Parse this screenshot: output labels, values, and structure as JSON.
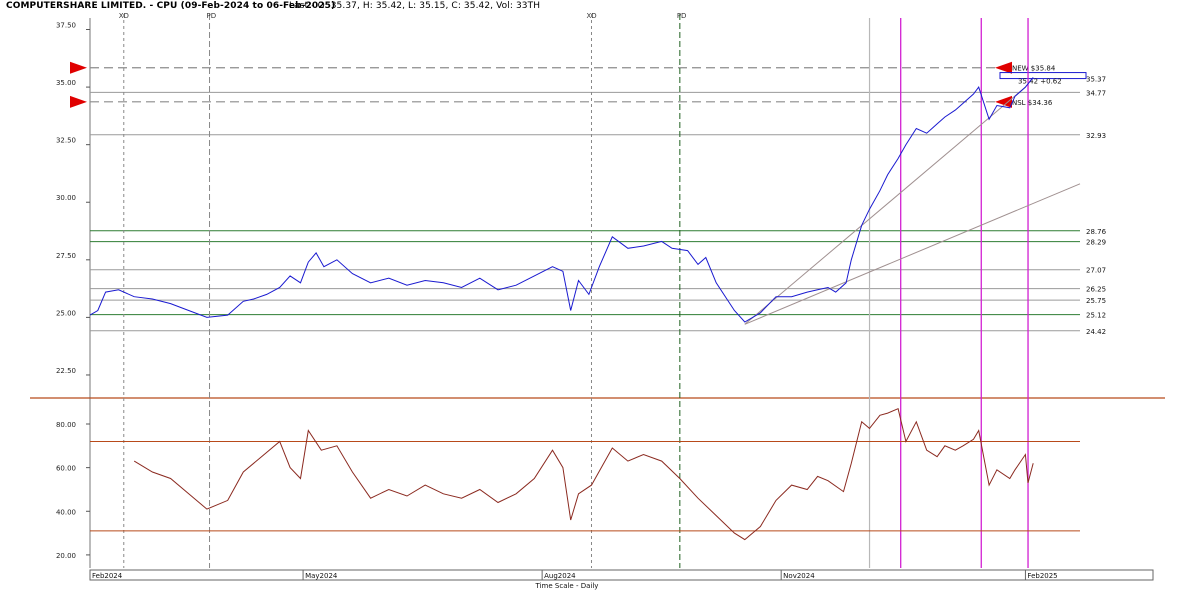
{
  "header": {
    "title": "COMPUTERSHARE LIMITED. - CPU (09-Feb-2024 to 06-Feb-2025)",
    "last_prices": "Last:- O: 35.37, H: 35.42, L: 35.15, C: 35.42, Vol: 33TH"
  },
  "colors": {
    "price": "#1a1ad0",
    "rsi": "#8b2a20",
    "divider": "#b84a1a",
    "green_level": "#2e7d32",
    "grey_level": "#9a9a9a",
    "dashed": "#8c8c8c",
    "magenta": "#d21fd2",
    "trend": "#a09090",
    "marker": "#e00000",
    "fd_line": "#1f5f1f"
  },
  "chart_data": [
    {
      "type": "line",
      "title": "",
      "series": [
        {
          "name": "",
          "points": [
            [
              "2024-02-09",
              25.1
            ],
            [
              "2024-02-12",
              25.3
            ],
            [
              "2024-02-15",
              26.1
            ],
            [
              "2024-02-20",
              26.2
            ],
            [
              "2024-02-26",
              25.9
            ],
            [
              "2024-03-04",
              25.8
            ],
            [
              "2024-03-11",
              25.6
            ],
            [
              "2024-03-18",
              25.3
            ],
            [
              "2024-03-25",
              25.0
            ],
            [
              "2024-04-02",
              25.1
            ],
            [
              "2024-04-08",
              25.7
            ],
            [
              "2024-04-12",
              25.8
            ],
            [
              "2024-04-17",
              26.0
            ],
            [
              "2024-04-22",
              26.3
            ],
            [
              "2024-04-26",
              26.8
            ],
            [
              "2024-04-30",
              26.5
            ],
            [
              "2024-05-03",
              27.4
            ],
            [
              "2024-05-06",
              27.8
            ],
            [
              "2024-05-09",
              27.2
            ],
            [
              "2024-05-14",
              27.5
            ],
            [
              "2024-05-20",
              26.9
            ],
            [
              "2024-05-27",
              26.5
            ],
            [
              "2024-06-03",
              26.7
            ],
            [
              "2024-06-10",
              26.4
            ],
            [
              "2024-06-17",
              26.6
            ],
            [
              "2024-06-24",
              26.5
            ],
            [
              "2024-07-01",
              26.3
            ],
            [
              "2024-07-08",
              26.7
            ],
            [
              "2024-07-15",
              26.2
            ],
            [
              "2024-07-22",
              26.4
            ],
            [
              "2024-07-29",
              26.8
            ],
            [
              "2024-08-05",
              27.2
            ],
            [
              "2024-08-09",
              27.0
            ],
            [
              "2024-08-12",
              25.3
            ],
            [
              "2024-08-15",
              26.6
            ],
            [
              "2024-08-19",
              26.0
            ],
            [
              "2024-08-23",
              27.2
            ],
            [
              "2024-08-28",
              28.5
            ],
            [
              "2024-09-03",
              28.0
            ],
            [
              "2024-09-09",
              28.1
            ],
            [
              "2024-09-16",
              28.3
            ],
            [
              "2024-09-20",
              28.0
            ],
            [
              "2024-09-26",
              27.9
            ],
            [
              "2024-09-30",
              27.3
            ],
            [
              "2024-10-03",
              27.6
            ],
            [
              "2024-10-07",
              26.5
            ],
            [
              "2024-10-14",
              25.3
            ],
            [
              "2024-10-18",
              24.8
            ],
            [
              "2024-10-24",
              25.2
            ],
            [
              "2024-10-30",
              25.9
            ],
            [
              "2024-11-05",
              25.9
            ],
            [
              "2024-11-11",
              26.1
            ],
            [
              "2024-11-15",
              26.2
            ],
            [
              "2024-11-19",
              26.3
            ],
            [
              "2024-11-22",
              26.1
            ],
            [
              "2024-11-26",
              26.5
            ],
            [
              "2024-11-28",
              27.5
            ],
            [
              "2024-12-02",
              29.0
            ],
            [
              "2024-12-05",
              29.7
            ],
            [
              "2024-12-09",
              30.5
            ],
            [
              "2024-12-12",
              31.2
            ],
            [
              "2024-12-16",
              31.9
            ],
            [
              "2024-12-19",
              32.5
            ],
            [
              "2024-12-23",
              33.2
            ],
            [
              "2024-12-27",
              33.0
            ],
            [
              "2024-12-31",
              33.4
            ],
            [
              "2025-01-03",
              33.7
            ],
            [
              "2025-01-07",
              34.0
            ],
            [
              "2025-01-10",
              34.3
            ],
            [
              "2025-01-14",
              34.7
            ],
            [
              "2025-01-16",
              35.0
            ],
            [
              "2025-01-20",
              33.6
            ],
            [
              "2025-01-23",
              34.2
            ],
            [
              "2025-01-28",
              34.1
            ],
            [
              "2025-01-30",
              34.6
            ],
            [
              "2025-02-03",
              35.0
            ],
            [
              "2025-02-06",
              35.42
            ]
          ]
        }
      ],
      "ylim": [
        21.5,
        38.0
      ],
      "y_ticks": [
        "37.50",
        "35.00",
        "32.50",
        "30.00",
        "27.50",
        "25.00",
        "22.50"
      ],
      "levels": {
        "green": [
          "28.76",
          "28.29",
          "25.12"
        ],
        "grey": [
          "34.77",
          "32.93",
          "27.07",
          "26.25",
          "25.75",
          "24.42"
        ]
      },
      "guides": {
        "new": "NEW $35.84",
        "nsl": "NSL $34.36",
        "last": "35.37",
        "pp_label": "35.42 +0.62"
      },
      "event_labels": {
        "xd": "XD",
        "pd": "PD"
      },
      "event_dates": {
        "xd": [
          "2024-02-22",
          "2024-08-20"
        ],
        "pd": [
          "2024-03-26",
          "2024-09-23"
        ]
      },
      "magenta_dates": [
        "2024-12-17",
        "2025-01-17",
        "2025-02-04"
      ],
      "grey_vline_date": "2024-12-05",
      "trendlines": [
        {
          "from": [
            "2024-10-18",
            24.7
          ],
          "to": [
            "2025-02-03",
            35.0
          ]
        },
        {
          "from": [
            "2024-10-18",
            24.7
          ],
          "to": [
            "2025-02-24",
            30.8
          ]
        }
      ]
    },
    {
      "type": "line",
      "title": "",
      "series": [
        {
          "name": "",
          "points": [
            [
              "2024-02-26",
              63
            ],
            [
              "2024-03-04",
              58
            ],
            [
              "2024-03-11",
              55
            ],
            [
              "2024-03-18",
              48
            ],
            [
              "2024-03-25",
              41
            ],
            [
              "2024-04-02",
              45
            ],
            [
              "2024-04-08",
              58
            ],
            [
              "2024-04-15",
              65
            ],
            [
              "2024-04-22",
              72
            ],
            [
              "2024-04-26",
              60
            ],
            [
              "2024-04-30",
              55
            ],
            [
              "2024-05-03",
              77
            ],
            [
              "2024-05-08",
              68
            ],
            [
              "2024-05-14",
              70
            ],
            [
              "2024-05-20",
              58
            ],
            [
              "2024-05-27",
              46
            ],
            [
              "2024-06-03",
              50
            ],
            [
              "2024-06-10",
              47
            ],
            [
              "2024-06-17",
              52
            ],
            [
              "2024-06-24",
              48
            ],
            [
              "2024-07-01",
              46
            ],
            [
              "2024-07-08",
              50
            ],
            [
              "2024-07-15",
              44
            ],
            [
              "2024-07-22",
              48
            ],
            [
              "2024-07-29",
              55
            ],
            [
              "2024-08-05",
              68
            ],
            [
              "2024-08-09",
              60
            ],
            [
              "2024-08-12",
              36
            ],
            [
              "2024-08-15",
              48
            ],
            [
              "2024-08-20",
              52
            ],
            [
              "2024-08-28",
              69
            ],
            [
              "2024-09-03",
              63
            ],
            [
              "2024-09-09",
              66
            ],
            [
              "2024-09-16",
              63
            ],
            [
              "2024-09-23",
              55
            ],
            [
              "2024-09-30",
              46
            ],
            [
              "2024-10-07",
              38
            ],
            [
              "2024-10-14",
              30
            ],
            [
              "2024-10-18",
              27
            ],
            [
              "2024-10-24",
              33
            ],
            [
              "2024-10-30",
              45
            ],
            [
              "2024-11-05",
              52
            ],
            [
              "2024-11-11",
              50
            ],
            [
              "2024-11-15",
              56
            ],
            [
              "2024-11-19",
              54
            ],
            [
              "2024-11-25",
              49
            ],
            [
              "2024-11-28",
              62
            ],
            [
              "2024-12-02",
              81
            ],
            [
              "2024-12-05",
              78
            ],
            [
              "2024-12-09",
              84
            ],
            [
              "2024-12-12",
              85
            ],
            [
              "2024-12-16",
              87
            ],
            [
              "2024-12-19",
              72
            ],
            [
              "2024-12-23",
              81
            ],
            [
              "2024-12-27",
              68
            ],
            [
              "2024-12-31",
              65
            ],
            [
              "2025-01-03",
              70
            ],
            [
              "2025-01-07",
              68
            ],
            [
              "2025-01-10",
              70
            ],
            [
              "2025-01-14",
              73
            ],
            [
              "2025-01-16",
              77
            ],
            [
              "2025-01-20",
              52
            ],
            [
              "2025-01-23",
              59
            ],
            [
              "2025-01-28",
              55
            ],
            [
              "2025-01-30",
              59
            ],
            [
              "2025-02-03",
              66
            ],
            [
              "2025-02-04",
              53
            ],
            [
              "2025-02-06",
              62
            ]
          ]
        }
      ],
      "ylim": [
        14,
        91
      ],
      "y_ticks": [
        "80.00",
        "60.00",
        "40.00",
        "20.00"
      ],
      "bands": [
        72,
        31
      ]
    }
  ],
  "time_axis": {
    "labels": [
      "Feb2024",
      "May2024",
      "Aug2024",
      "Nov2024",
      "Feb2025"
    ],
    "caption": "Time Scale - Daily"
  }
}
